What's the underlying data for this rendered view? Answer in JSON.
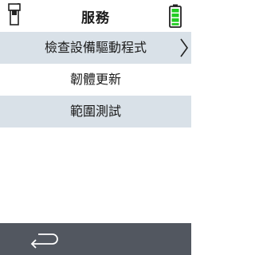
{
  "header": {
    "title": "服務",
    "left_icon": "device-icon",
    "right_icon": "battery-icon",
    "battery_color": "#22cc22"
  },
  "menu": {
    "items": [
      {
        "label": "檢查設備驅動程式",
        "selected": true,
        "icon": "chevron-right-icon"
      },
      {
        "label": "韌體更新",
        "selected": false
      },
      {
        "label": "範圍測試",
        "selected": false
      }
    ]
  },
  "footer": {
    "icon": "back-icon"
  },
  "colors": {
    "shaded_row": "#d9e1e8",
    "footer_bg": "#525760"
  }
}
